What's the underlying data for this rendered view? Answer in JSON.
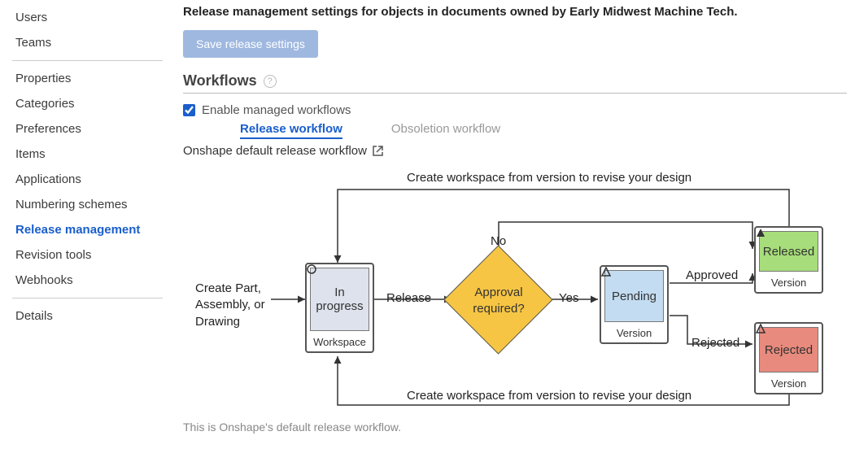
{
  "sidebar": {
    "groups": [
      [
        "Users",
        "Teams"
      ],
      [
        "Properties",
        "Categories",
        "Preferences",
        "Items",
        "Applications",
        "Numbering schemes",
        "Release management",
        "Revision tools",
        "Webhooks"
      ],
      [
        "Details"
      ]
    ],
    "active": "Release management"
  },
  "page": {
    "title": "Release management settings for objects in documents owned by Early Midwest Machine Tech.",
    "save_btn": "Save release settings",
    "workflows_heading": "Workflows",
    "enable_label": "Enable managed workflows",
    "enable_checked": true,
    "tabs": {
      "release": "Release workflow",
      "obsoletion": "Obsoletion workflow"
    },
    "workflow_name": "Onshape default release workflow",
    "footer_note": "This is Onshape's default release workflow."
  },
  "diagram": {
    "top_note": "Create workspace from version to revise your design",
    "bottom_note": "Create workspace from version to revise your design",
    "start_text": "Create Part, Assembly, or Drawing",
    "in_progress": {
      "label": "In progress",
      "caption": "Workspace"
    },
    "decision": "Approval required?",
    "pending": {
      "label": "Pending",
      "caption": "Version"
    },
    "released": {
      "label": "Released",
      "caption": "Version"
    },
    "rejected": {
      "label": "Rejected",
      "caption": "Version"
    },
    "edges": {
      "release": "Release",
      "yes": "Yes",
      "no": "No",
      "approved": "Approved",
      "rejected": "Rejected"
    }
  }
}
